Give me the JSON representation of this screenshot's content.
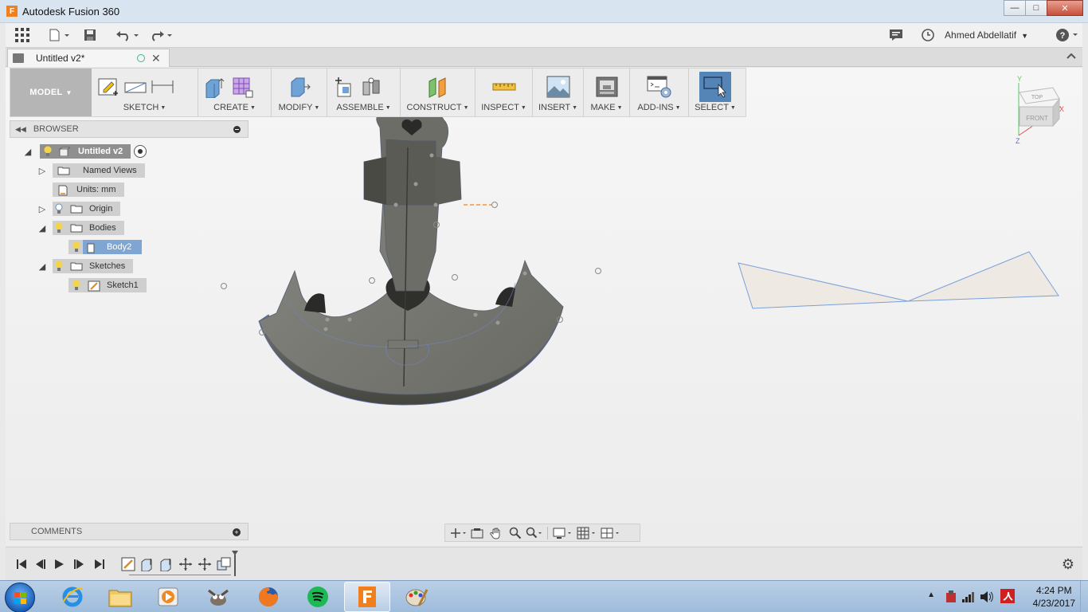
{
  "window": {
    "title": "Autodesk Fusion 360",
    "app_logo": "F",
    "minimize": "—",
    "maximize": "□",
    "close": "✕"
  },
  "qat": {
    "user_name": "Ahmed Abdellatif"
  },
  "document_tab": {
    "label": "Untitled v2*"
  },
  "ribbon": {
    "workspace": "MODEL",
    "groups": [
      "SKETCH",
      "CREATE",
      "MODIFY",
      "ASSEMBLE",
      "CONSTRUCT",
      "INSPECT",
      "INSERT",
      "MAKE",
      "ADD-INS",
      "SELECT"
    ]
  },
  "browser": {
    "header": "BROWSER",
    "root": "Untitled v2",
    "items": {
      "named_views": "Named Views",
      "units": "Units: mm",
      "origin": "Origin",
      "bodies": "Bodies",
      "body2": "Body2",
      "sketches": "Sketches",
      "sketch1": "Sketch1"
    }
  },
  "comments": {
    "header": "COMMENTS"
  },
  "viewcube": {
    "top": "TOP",
    "front": "FRONT",
    "axis_y": "Y",
    "axis_x": "X",
    "axis_z": "Z"
  },
  "taskbar": {
    "time": "4:24 PM",
    "date": "4/23/2017"
  },
  "colors": {
    "select_active": "#5584b6",
    "body_face": "#6b6b67",
    "sketch_line": "#7aa0d8",
    "orange": "#f0801e"
  }
}
